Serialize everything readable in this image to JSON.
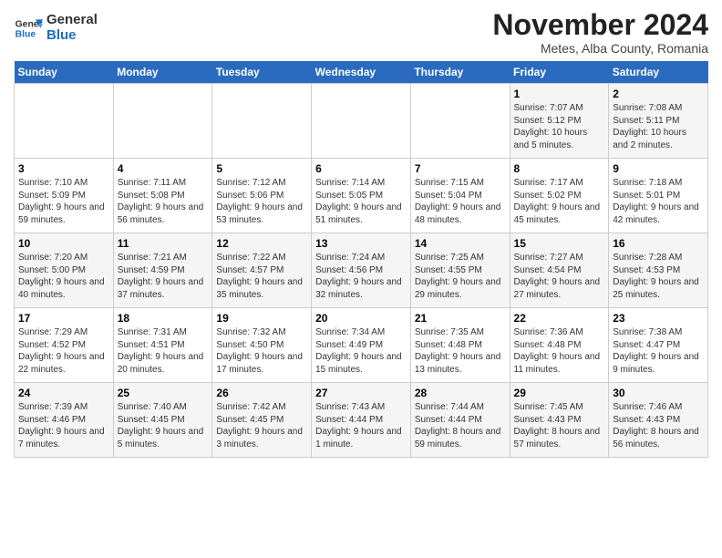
{
  "logo": {
    "line1": "General",
    "line2": "Blue"
  },
  "title": "November 2024",
  "subtitle": "Metes, Alba County, Romania",
  "days_of_week": [
    "Sunday",
    "Monday",
    "Tuesday",
    "Wednesday",
    "Thursday",
    "Friday",
    "Saturday"
  ],
  "weeks": [
    [
      {
        "day": "",
        "info": ""
      },
      {
        "day": "",
        "info": ""
      },
      {
        "day": "",
        "info": ""
      },
      {
        "day": "",
        "info": ""
      },
      {
        "day": "",
        "info": ""
      },
      {
        "day": "1",
        "info": "Sunrise: 7:07 AM\nSunset: 5:12 PM\nDaylight: 10 hours and 5 minutes."
      },
      {
        "day": "2",
        "info": "Sunrise: 7:08 AM\nSunset: 5:11 PM\nDaylight: 10 hours and 2 minutes."
      }
    ],
    [
      {
        "day": "3",
        "info": "Sunrise: 7:10 AM\nSunset: 5:09 PM\nDaylight: 9 hours and 59 minutes."
      },
      {
        "day": "4",
        "info": "Sunrise: 7:11 AM\nSunset: 5:08 PM\nDaylight: 9 hours and 56 minutes."
      },
      {
        "day": "5",
        "info": "Sunrise: 7:12 AM\nSunset: 5:06 PM\nDaylight: 9 hours and 53 minutes."
      },
      {
        "day": "6",
        "info": "Sunrise: 7:14 AM\nSunset: 5:05 PM\nDaylight: 9 hours and 51 minutes."
      },
      {
        "day": "7",
        "info": "Sunrise: 7:15 AM\nSunset: 5:04 PM\nDaylight: 9 hours and 48 minutes."
      },
      {
        "day": "8",
        "info": "Sunrise: 7:17 AM\nSunset: 5:02 PM\nDaylight: 9 hours and 45 minutes."
      },
      {
        "day": "9",
        "info": "Sunrise: 7:18 AM\nSunset: 5:01 PM\nDaylight: 9 hours and 42 minutes."
      }
    ],
    [
      {
        "day": "10",
        "info": "Sunrise: 7:20 AM\nSunset: 5:00 PM\nDaylight: 9 hours and 40 minutes."
      },
      {
        "day": "11",
        "info": "Sunrise: 7:21 AM\nSunset: 4:59 PM\nDaylight: 9 hours and 37 minutes."
      },
      {
        "day": "12",
        "info": "Sunrise: 7:22 AM\nSunset: 4:57 PM\nDaylight: 9 hours and 35 minutes."
      },
      {
        "day": "13",
        "info": "Sunrise: 7:24 AM\nSunset: 4:56 PM\nDaylight: 9 hours and 32 minutes."
      },
      {
        "day": "14",
        "info": "Sunrise: 7:25 AM\nSunset: 4:55 PM\nDaylight: 9 hours and 29 minutes."
      },
      {
        "day": "15",
        "info": "Sunrise: 7:27 AM\nSunset: 4:54 PM\nDaylight: 9 hours and 27 minutes."
      },
      {
        "day": "16",
        "info": "Sunrise: 7:28 AM\nSunset: 4:53 PM\nDaylight: 9 hours and 25 minutes."
      }
    ],
    [
      {
        "day": "17",
        "info": "Sunrise: 7:29 AM\nSunset: 4:52 PM\nDaylight: 9 hours and 22 minutes."
      },
      {
        "day": "18",
        "info": "Sunrise: 7:31 AM\nSunset: 4:51 PM\nDaylight: 9 hours and 20 minutes."
      },
      {
        "day": "19",
        "info": "Sunrise: 7:32 AM\nSunset: 4:50 PM\nDaylight: 9 hours and 17 minutes."
      },
      {
        "day": "20",
        "info": "Sunrise: 7:34 AM\nSunset: 4:49 PM\nDaylight: 9 hours and 15 minutes."
      },
      {
        "day": "21",
        "info": "Sunrise: 7:35 AM\nSunset: 4:48 PM\nDaylight: 9 hours and 13 minutes."
      },
      {
        "day": "22",
        "info": "Sunrise: 7:36 AM\nSunset: 4:48 PM\nDaylight: 9 hours and 11 minutes."
      },
      {
        "day": "23",
        "info": "Sunrise: 7:38 AM\nSunset: 4:47 PM\nDaylight: 9 hours and 9 minutes."
      }
    ],
    [
      {
        "day": "24",
        "info": "Sunrise: 7:39 AM\nSunset: 4:46 PM\nDaylight: 9 hours and 7 minutes."
      },
      {
        "day": "25",
        "info": "Sunrise: 7:40 AM\nSunset: 4:45 PM\nDaylight: 9 hours and 5 minutes."
      },
      {
        "day": "26",
        "info": "Sunrise: 7:42 AM\nSunset: 4:45 PM\nDaylight: 9 hours and 3 minutes."
      },
      {
        "day": "27",
        "info": "Sunrise: 7:43 AM\nSunset: 4:44 PM\nDaylight: 9 hours and 1 minute."
      },
      {
        "day": "28",
        "info": "Sunrise: 7:44 AM\nSunset: 4:44 PM\nDaylight: 8 hours and 59 minutes."
      },
      {
        "day": "29",
        "info": "Sunrise: 7:45 AM\nSunset: 4:43 PM\nDaylight: 8 hours and 57 minutes."
      },
      {
        "day": "30",
        "info": "Sunrise: 7:46 AM\nSunset: 4:43 PM\nDaylight: 8 hours and 56 minutes."
      }
    ]
  ]
}
